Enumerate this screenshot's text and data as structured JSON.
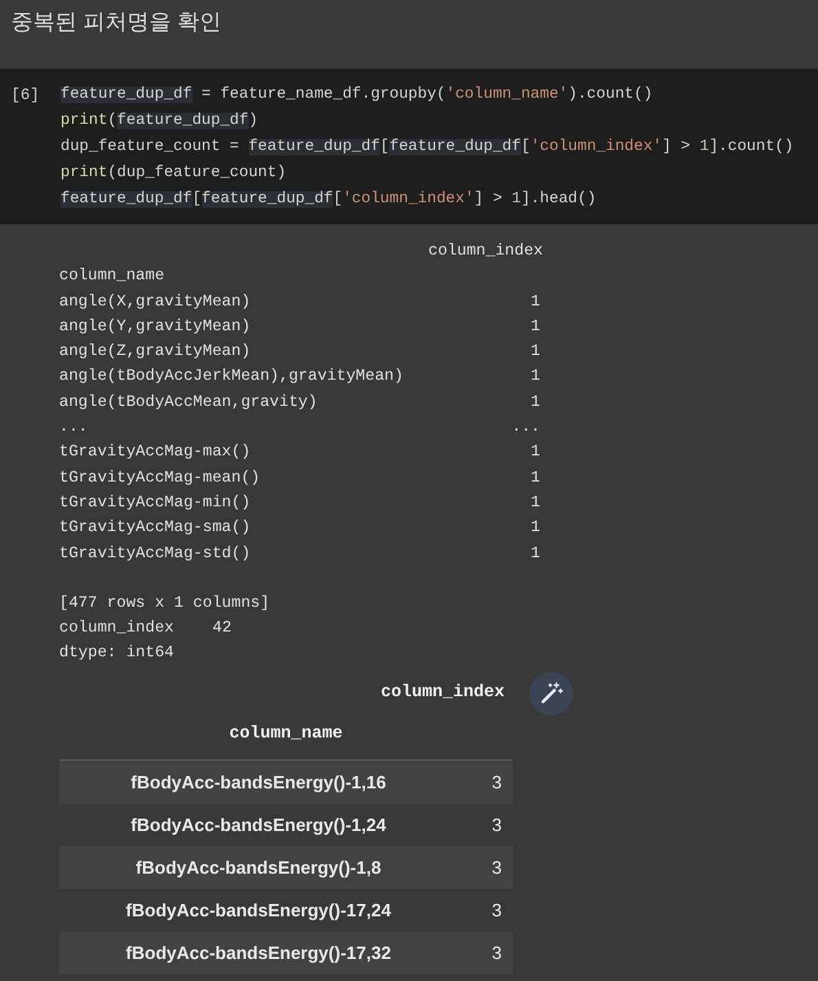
{
  "markdown_heading": "중복된 피처명을 확인",
  "code_cell": {
    "prompt": "[6]",
    "lines": [
      [
        {
          "text": "feature_dup_df",
          "kind": "var"
        },
        {
          "text": " = feature_name_df.groupby(",
          "kind": "plain"
        },
        {
          "text": "'column_name'",
          "kind": "string"
        },
        {
          "text": ").count()",
          "kind": "plain"
        }
      ],
      [
        {
          "text": "print",
          "kind": "func"
        },
        {
          "text": "(",
          "kind": "plain"
        },
        {
          "text": "feature_dup_df",
          "kind": "var"
        },
        {
          "text": ")",
          "kind": "plain"
        }
      ],
      [
        {
          "text": "dup_feature_count = ",
          "kind": "plain"
        },
        {
          "text": "feature_dup_df",
          "kind": "var"
        },
        {
          "text": "[",
          "kind": "plain"
        },
        {
          "text": "feature_dup_df",
          "kind": "var"
        },
        {
          "text": "[",
          "kind": "plain"
        },
        {
          "text": "'column_index'",
          "kind": "string"
        },
        {
          "text": "] > ",
          "kind": "plain"
        },
        {
          "text": "1",
          "kind": "number"
        },
        {
          "text": "].count()",
          "kind": "plain"
        }
      ],
      [
        {
          "text": "print",
          "kind": "func"
        },
        {
          "text": "(dup_feature_count)",
          "kind": "plain"
        }
      ],
      [
        {
          "text": "feature_dup_df",
          "kind": "var"
        },
        {
          "text": "[",
          "kind": "plain"
        },
        {
          "text": "feature_dup_df",
          "kind": "var"
        },
        {
          "text": "[",
          "kind": "plain"
        },
        {
          "text": "'column_index'",
          "kind": "string"
        },
        {
          "text": "] > ",
          "kind": "plain"
        },
        {
          "text": "1",
          "kind": "number"
        },
        {
          "text": "].head()",
          "kind": "plain"
        }
      ]
    ]
  },
  "text_output": {
    "column_header": "column_index",
    "index_name": "column_name",
    "rows": [
      {
        "name": "angle(X,gravityMean)",
        "value": "1"
      },
      {
        "name": "angle(Y,gravityMean)",
        "value": "1"
      },
      {
        "name": "angle(Z,gravityMean)",
        "value": "1"
      },
      {
        "name": "angle(tBodyAccJerkMean),gravityMean)",
        "value": "1"
      },
      {
        "name": "angle(tBodyAccMean,gravity)",
        "value": "1"
      },
      {
        "name": "...",
        "value": "..."
      },
      {
        "name": "tGravityAccMag-max()",
        "value": "1"
      },
      {
        "name": "tGravityAccMag-mean()",
        "value": "1"
      },
      {
        "name": "tGravityAccMag-min()",
        "value": "1"
      },
      {
        "name": "tGravityAccMag-sma()",
        "value": "1"
      },
      {
        "name": "tGravityAccMag-std()",
        "value": "1"
      }
    ],
    "summary": "[477 rows x 1 columns]",
    "series": [
      {
        "name": "column_index",
        "value": "42"
      }
    ],
    "dtype": "dtype: int64"
  },
  "html_table": {
    "column_header": "column_index",
    "index_name": "column_name",
    "rows": [
      {
        "name": "fBodyAcc-bandsEnergy()-1,16",
        "value": "3"
      },
      {
        "name": "fBodyAcc-bandsEnergy()-1,24",
        "value": "3"
      },
      {
        "name": "fBodyAcc-bandsEnergy()-1,8",
        "value": "3"
      },
      {
        "name": "fBodyAcc-bandsEnergy()-17,24",
        "value": "3"
      },
      {
        "name": "fBodyAcc-bandsEnergy()-17,32",
        "value": "3"
      }
    ]
  }
}
